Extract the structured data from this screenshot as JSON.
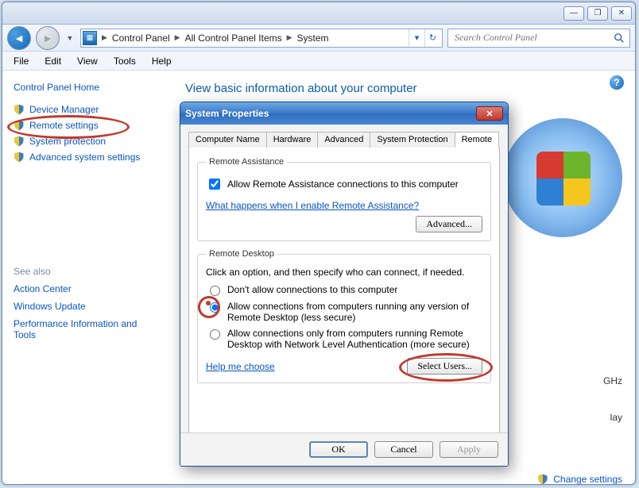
{
  "window": {
    "breadcrumbs": [
      "Control Panel",
      "All Control Panel Items",
      "System"
    ]
  },
  "search": {
    "placeholder": "Search Control Panel"
  },
  "menus": [
    "File",
    "Edit",
    "View",
    "Tools",
    "Help"
  ],
  "sidebar": {
    "home": "Control Panel Home",
    "items": [
      "Device Manager",
      "Remote settings",
      "System protection",
      "Advanced system settings"
    ],
    "seealso_label": "See also",
    "seealso": [
      "Action Center",
      "Windows Update",
      "Performance Information and Tools"
    ]
  },
  "page": {
    "heading": "View basic information about your computer",
    "bg_text1": "GHz",
    "bg_text2": "lay",
    "change_settings": "Change settings"
  },
  "dialog": {
    "title": "System Properties",
    "tabs": [
      "Computer Name",
      "Hardware",
      "Advanced",
      "System Protection",
      "Remote"
    ],
    "active_tab": 4,
    "ra": {
      "legend": "Remote Assistance",
      "checkbox": "Allow Remote Assistance connections to this computer",
      "checked": true,
      "help": "What happens when I enable Remote Assistance?",
      "advanced": "Advanced..."
    },
    "rd": {
      "legend": "Remote Desktop",
      "desc": "Click an option, and then specify who can connect, if needed.",
      "opt1": "Don't allow connections to this computer",
      "opt2": "Allow connections from computers running any version of Remote Desktop (less secure)",
      "opt3": "Allow connections only from computers running Remote Desktop with Network Level Authentication (more secure)",
      "selected": 1,
      "help": "Help me choose",
      "select_users": "Select Users..."
    },
    "buttons": {
      "ok": "OK",
      "cancel": "Cancel",
      "apply": "Apply"
    }
  }
}
